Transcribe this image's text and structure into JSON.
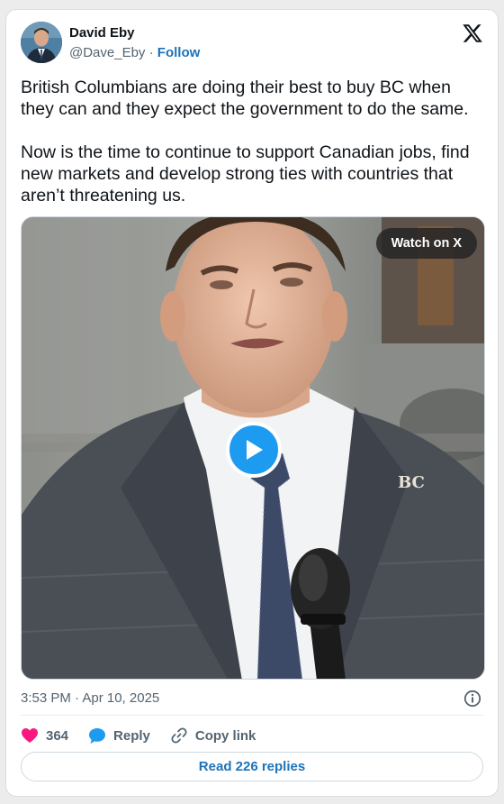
{
  "author": {
    "name": "David Eby",
    "handle": "@Dave_Eby",
    "separator": "·",
    "follow_label": "Follow"
  },
  "tweet": {
    "text": "British Columbians are doing their best to buy BC when they can and they expect the government to do the same.\n\nNow is the time to continue to support Canadian jobs, find new markets and develop strong ties with countries that aren’t threatening us.",
    "timestamp": "3:53 PM · Apr 10, 2025"
  },
  "media": {
    "watch_label": "Watch on X",
    "play_icon": "play-icon",
    "pin_text": "BC"
  },
  "actions": {
    "like_count": "364",
    "reply_label": "Reply",
    "copy_link_label": "Copy link"
  },
  "read_replies_label": "Read 226 replies",
  "colors": {
    "like": "#f91880",
    "reply": "#1d9bf0",
    "link": "#1d73b8",
    "play": "#1d9bf0"
  },
  "icons": [
    "x-logo-icon",
    "info-icon",
    "heart-icon",
    "speech-bubble-icon",
    "link-icon",
    "play-icon"
  ]
}
